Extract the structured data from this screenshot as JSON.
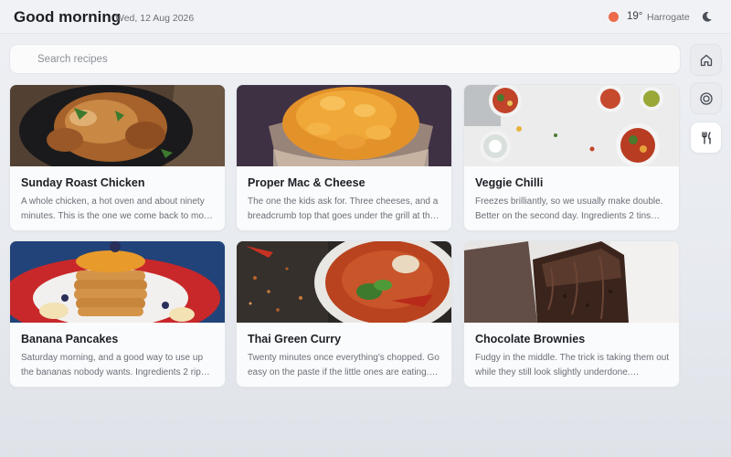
{
  "header": {
    "greeting": "Good morning",
    "date": "Wed, 12 Aug 2026",
    "weather": {
      "temperature": "19°",
      "location": "Harrogate",
      "indicator_color": "#ec6a4a"
    },
    "theme_icon": "moon-icon"
  },
  "search": {
    "placeholder": "Search recipes",
    "value": ""
  },
  "nav": [
    {
      "icon": "home-icon",
      "active": false
    },
    {
      "icon": "target-icon",
      "active": false
    },
    {
      "icon": "fork-knife-icon",
      "active": true
    }
  ],
  "recipes": [
    {
      "title": "Sunday Roast Chicken",
      "description": "A whole chicken, a hot oven and about ninety minutes. This is the one we come back to mo…"
    },
    {
      "title": "Proper Mac & Cheese",
      "description": "The one the kids ask for. Three cheeses, and a breadcrumb top that goes under the grill at th…"
    },
    {
      "title": "Veggie Chilli",
      "description": "Freezes brilliantly, so we usually make double. Better on the second day. Ingredients 2 tins…"
    },
    {
      "title": "Banana Pancakes",
      "description": "Saturday morning, and a good way to use up the bananas nobody wants. Ingredients 2 rip…"
    },
    {
      "title": "Thai Green Curry",
      "description": "Twenty minutes once everything's chopped. Go easy on the paste if the little ones are eating.…"
    },
    {
      "title": "Chocolate Brownies",
      "description": "Fudgy in the middle. The trick is taking them out while they still look slightly underdone.…"
    }
  ]
}
